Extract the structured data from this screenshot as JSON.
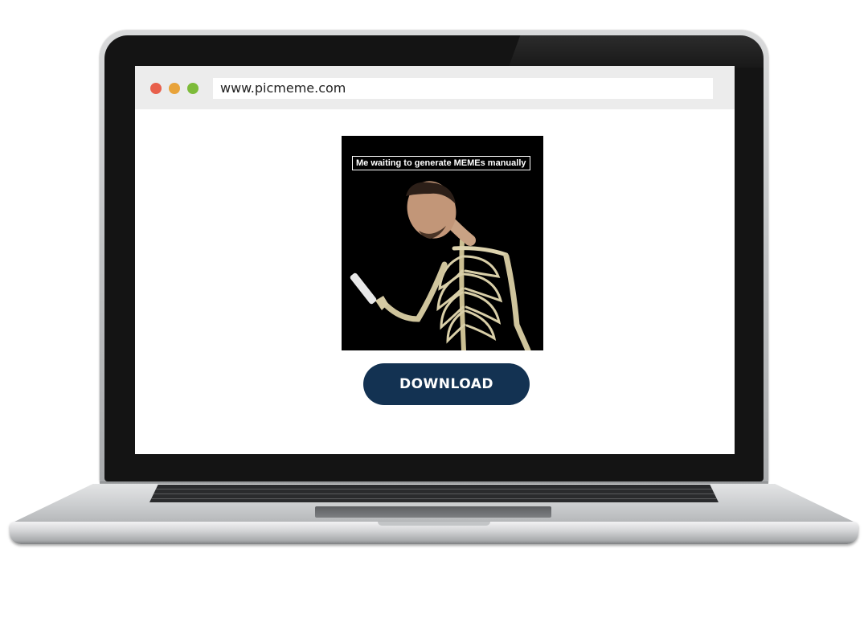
{
  "browser": {
    "url": "www.picmeme.com",
    "window_controls": [
      {
        "name": "close",
        "color": "#e8604c"
      },
      {
        "name": "minimize",
        "color": "#e8a33a"
      },
      {
        "name": "maximize",
        "color": "#7dbb3a"
      }
    ]
  },
  "meme": {
    "caption": "Me waiting to generate MEMEs manually",
    "background_color": "#000000"
  },
  "download_button": {
    "label": "DOWNLOAD",
    "color": "#133252"
  },
  "device": {
    "type": "laptop-mockup",
    "body_color": "#c9cbcd",
    "bezel_color": "#141414"
  }
}
